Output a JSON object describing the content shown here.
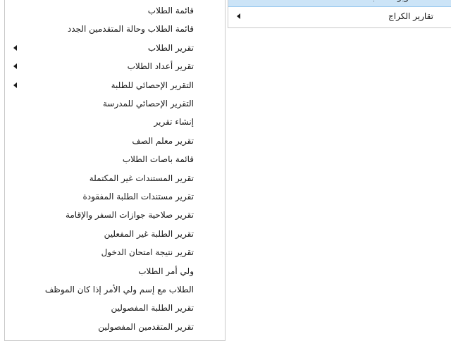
{
  "left_menu": {
    "items": [
      {
        "label": "قائمة الطلاب",
        "submenu": false
      },
      {
        "label": "قائمة الطلاب وحالة المتقدمين الجدد",
        "submenu": false
      },
      {
        "label": "تقرير الطلاب",
        "submenu": true
      },
      {
        "label": "تقرير أعداد الطلاب",
        "submenu": true
      },
      {
        "label": "التقرير الإحصائي للطلبة",
        "submenu": true
      },
      {
        "label": "التقرير الإحصائي للمدرسة",
        "submenu": false
      },
      {
        "label": "إنشاء تقرير",
        "submenu": false
      },
      {
        "label": "تقرير معلم الصف",
        "submenu": false
      },
      {
        "label": "قائمة باصات الطلاب",
        "submenu": false
      },
      {
        "label": "تقرير المستندات غير المكتملة",
        "submenu": false
      },
      {
        "label": "تقرير مستندات الطلبة المفقودة",
        "submenu": false
      },
      {
        "label": "تقرير صلاحية جوازات السفر والإقامة",
        "submenu": false
      },
      {
        "label": "تقرير الطلبة غير المفعلين",
        "submenu": false
      },
      {
        "label": "تقرير نتيجة امتحان الدخول",
        "submenu": false
      },
      {
        "label": "ولي أمر الطلاب",
        "submenu": false
      },
      {
        "label": "الطلاب مع إسم ولي الأمر إذا كان الموظف",
        "submenu": false
      },
      {
        "label": "تقرير الطلبة المفصولين",
        "submenu": false
      },
      {
        "label": "تقرير المتقدمين المفصولين",
        "submenu": false
      }
    ]
  },
  "right_menu": {
    "highlighted_item_label": "تقارير الطلاب",
    "items": [
      {
        "label": "تقارير الكراج",
        "submenu": true
      }
    ]
  }
}
